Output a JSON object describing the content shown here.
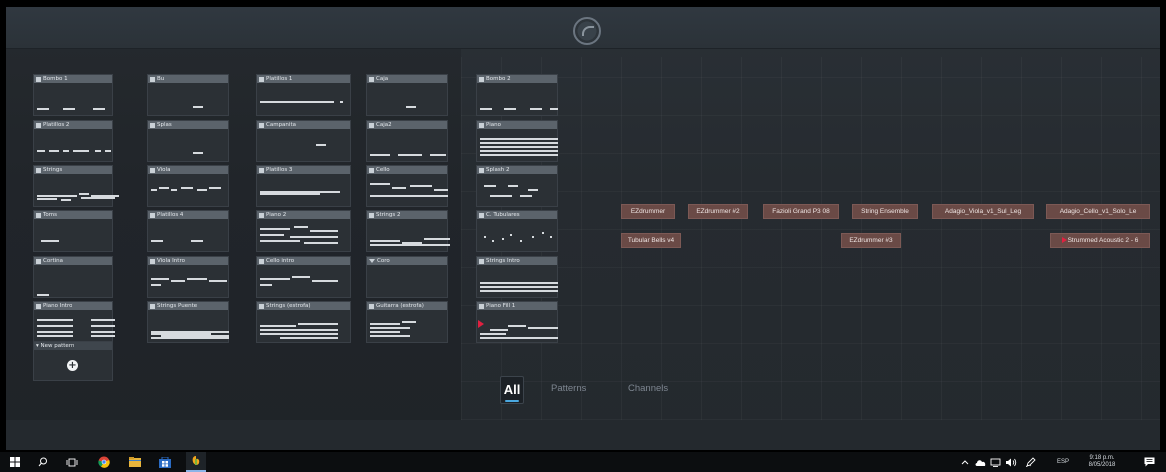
{
  "patterns": [
    {
      "name": "Bombo 1"
    },
    {
      "name": "Bu"
    },
    {
      "name": "Platillos 1"
    },
    {
      "name": "Caja"
    },
    {
      "name": "Bombo 2"
    },
    {
      "name": "Platillos 2"
    },
    {
      "name": "Splas"
    },
    {
      "name": "Campanita"
    },
    {
      "name": "Caja2"
    },
    {
      "name": "Piano"
    },
    {
      "name": "Strings"
    },
    {
      "name": "Viola"
    },
    {
      "name": "Platillos 3"
    },
    {
      "name": "Cello"
    },
    {
      "name": "Splash 2"
    },
    {
      "name": "Toms"
    },
    {
      "name": "Platillos 4"
    },
    {
      "name": "Piano 2"
    },
    {
      "name": "Strings 2"
    },
    {
      "name": "C. Tubulares"
    },
    {
      "name": "Cortina"
    },
    {
      "name": "Viola Intro"
    },
    {
      "name": "Cello intro"
    },
    {
      "name": "Coro"
    },
    {
      "name": "Strings Intro"
    },
    {
      "name": "Piano Intro"
    },
    {
      "name": "Strings Puente"
    },
    {
      "name": "Strings (estrofa)"
    },
    {
      "name": "Guitarra (estrofa)"
    },
    {
      "name": "Piano Fill 1"
    }
  ],
  "new_pattern": {
    "label": "New pattern",
    "icon": "plus-circle-icon"
  },
  "channels": [
    {
      "label": "EZdrummer"
    },
    {
      "label": "EZdrummer #2"
    },
    {
      "label": "Fazioli Grand P3 08"
    },
    {
      "label": "String Ensemble"
    },
    {
      "label": "Adagio_Viola_v1_Sul_Leg"
    },
    {
      "label": "Adagio_Cello_v1_Solo_Le"
    },
    {
      "label": "Tubular Bells v4"
    },
    {
      "label": "EZdrummer #3"
    },
    {
      "label": "Strummed Acoustic 2 - 6"
    }
  ],
  "filters": {
    "all": "All",
    "patterns": "Patterns",
    "channels": "Channels"
  },
  "taskbar": {
    "icons": [
      "windows-start-icon",
      "search-icon",
      "task-view-icon",
      "chrome-icon",
      "file-explorer-icon",
      "store-icon",
      "fl-studio-icon"
    ],
    "tray": {
      "language": "ESP",
      "time": "9:18 p.m.",
      "date": "8/05/2018"
    }
  }
}
